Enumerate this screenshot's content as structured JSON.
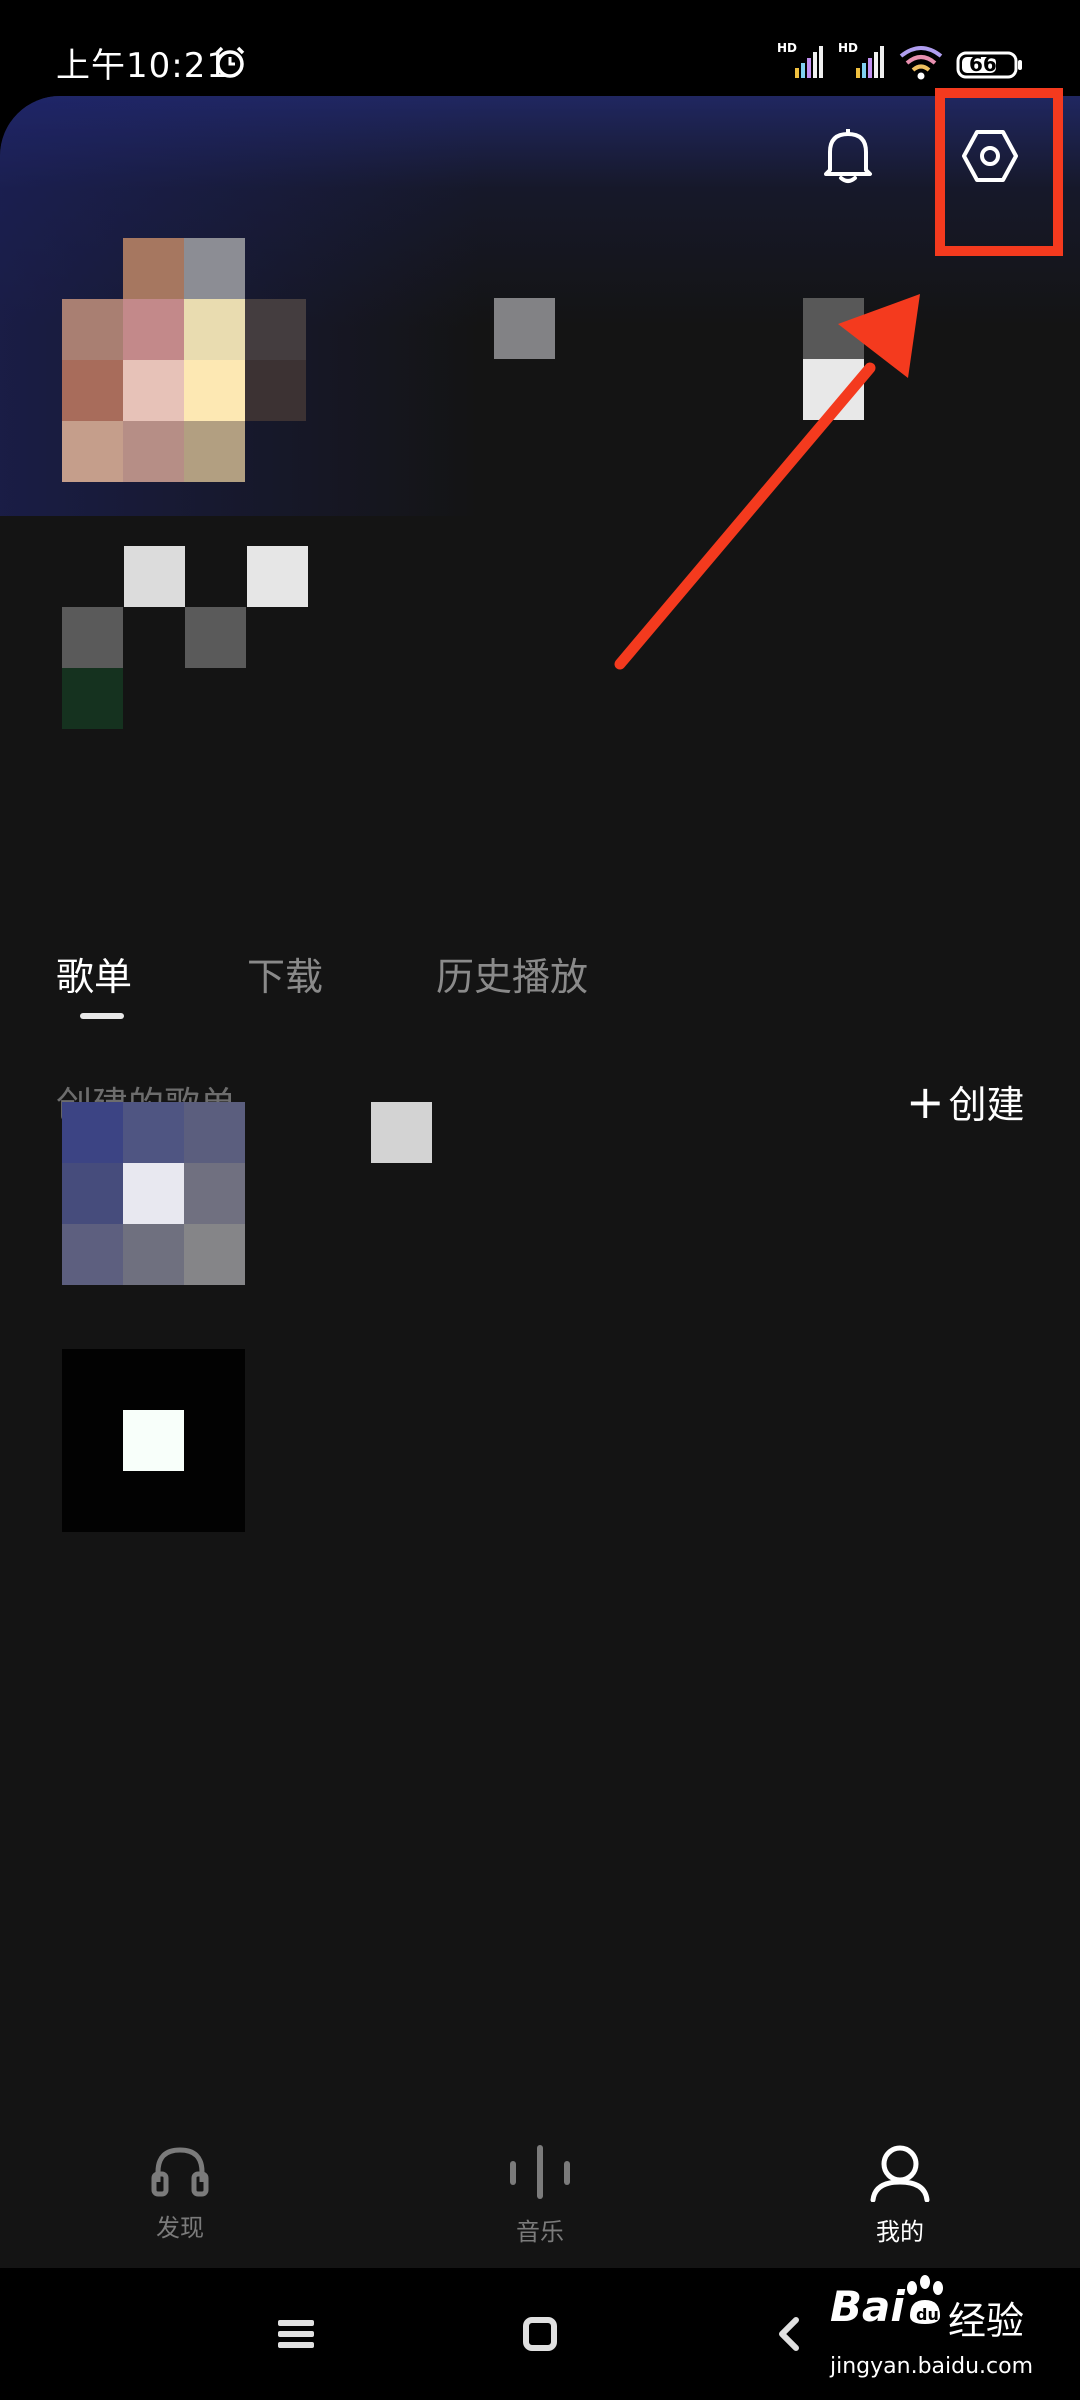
{
  "status_bar": {
    "time": "上午10:21",
    "battery": "66",
    "signal1_tag": "HD",
    "signal2_tag": "HD"
  },
  "header": {
    "bell_icon": "bell-icon",
    "settings_icon": "hexagon-settings-icon"
  },
  "tabs": [
    {
      "label": "歌单",
      "active": true
    },
    {
      "label": "下载",
      "active": false
    },
    {
      "label": "历史播放",
      "active": false
    }
  ],
  "playlist_section": {
    "title": "创建的歌单",
    "create_label": "创建"
  },
  "bottom_nav": [
    {
      "label": "发现",
      "icon": "headphones-icon",
      "active": false
    },
    {
      "label": "音乐",
      "icon": "waveform-icon",
      "active": false
    },
    {
      "label": "我的",
      "icon": "person-icon",
      "active": true
    }
  ],
  "watermark": {
    "brand": "Bai",
    "brand_cn": "经验",
    "url": "jingyan.baidu.com"
  },
  "colors": {
    "annotation_red": "#f43a1e",
    "background": "#141414"
  }
}
